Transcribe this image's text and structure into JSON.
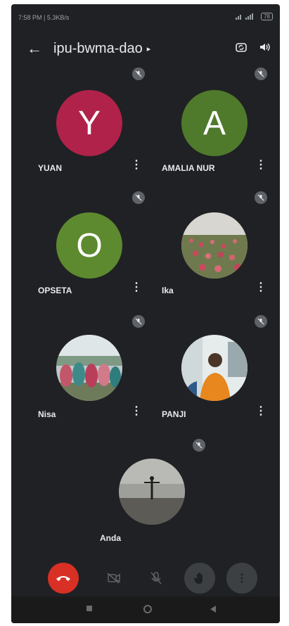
{
  "status_bar": {
    "time_info": "7:58 PM | 5.3KB/s",
    "battery": "78"
  },
  "header": {
    "meeting_code": "ipu-bwma-dao"
  },
  "participants": [
    {
      "name": "YUAN",
      "initial": "Y",
      "avatar_color": "#b0224a",
      "type": "initial",
      "muted": true
    },
    {
      "name": "AMALIA NUR",
      "initial": "A",
      "avatar_color": "#4f7a2c",
      "type": "initial",
      "muted": true
    },
    {
      "name": "OPSETA",
      "initial": "O",
      "avatar_color": "#5d8a2e",
      "type": "initial",
      "muted": true
    },
    {
      "name": "Ika",
      "type": "photo",
      "photo": "flower-field",
      "muted": true
    },
    {
      "name": "Nisa",
      "type": "photo",
      "photo": "group-outdoor",
      "muted": true
    },
    {
      "name": "PANJI",
      "type": "photo",
      "photo": "person-orange-jacket",
      "muted": true
    },
    {
      "name": "Anda",
      "type": "photo",
      "photo": "beach-silhouette",
      "muted": true
    }
  ],
  "controls": [
    {
      "name": "end-call",
      "icon": "phone-hangup-icon",
      "color": "#d93025"
    },
    {
      "name": "camera-off",
      "icon": "camera-off-icon"
    },
    {
      "name": "mic-off",
      "icon": "mic-off-icon"
    },
    {
      "name": "raise-hand",
      "icon": "hand-icon"
    },
    {
      "name": "more-options",
      "icon": "more-vert-icon"
    }
  ]
}
